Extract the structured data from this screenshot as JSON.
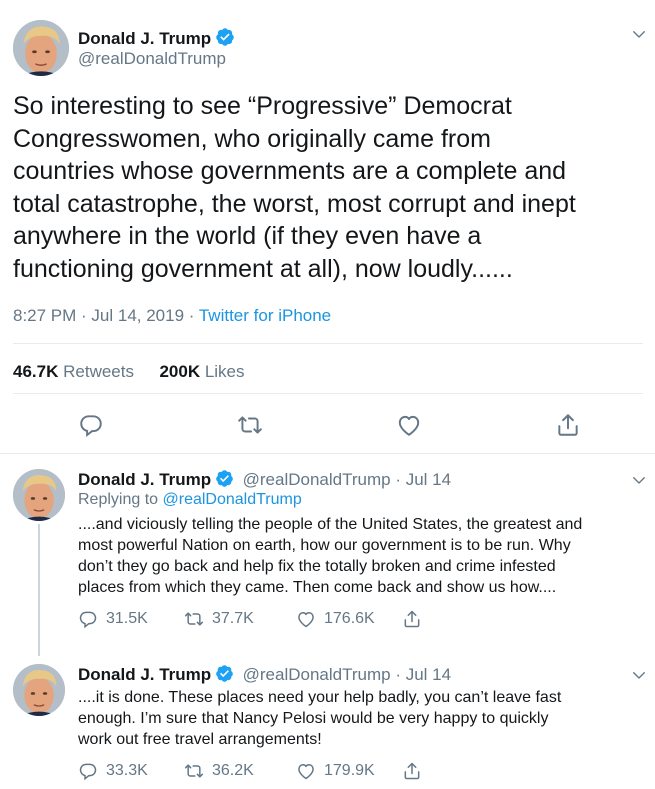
{
  "main": {
    "author_name": "Donald J. Trump",
    "author_handle": "@realDonaldTrump",
    "text": "So interesting to see “Progressive” Democrat\nCongresswomen, who originally came from\ncountries whose governments are a complete and\ntotal catastrophe, the worst, most corrupt and inept\nanywhere in the world (if they even have a\nfunctioning government at all), now loudly......",
    "time": "8:27 PM · Jul 14, 2019 · ",
    "source": "Twitter for iPhone",
    "retweets_count": "46.7K",
    "retweets_label": "Retweets",
    "likes_count": "200K",
    "likes_label": "Likes"
  },
  "replies": [
    {
      "author_name": "Donald J. Trump",
      "handle_date": "@realDonaldTrump · Jul 14",
      "replying_label": "Replying to ",
      "replying_handle": "@realDonaldTrump",
      "text": "....and viciously telling the people of the United States, the greatest and\nmost powerful Nation on earth, how our government is to be run. Why\ndon’t they go back and help fix the totally broken and crime infested\nplaces from which they came. Then come back and show us how....",
      "reply_count": "31.5K",
      "retweet_count": "37.7K",
      "like_count": "176.6K"
    },
    {
      "author_name": "Donald J. Trump",
      "handle_date": "@realDonaldTrump · Jul 14",
      "text": "....it is done. These places need your help badly, you can’t leave fast\nenough. I’m sure that Nancy Pelosi would be very happy to quickly\nwork out free travel arrangements!",
      "reply_count": "33.3K",
      "retweet_count": "36.2K",
      "like_count": "179.9K"
    }
  ],
  "icons": {
    "verified": "verified-badge-icon",
    "reply": "reply-icon",
    "retweet": "retweet-icon",
    "like": "like-icon",
    "share": "share-icon",
    "more": "chevron-down-icon"
  },
  "colors": {
    "accent": "#1da1f2",
    "link": "#1b95e0",
    "muted": "#657786",
    "text": "#14171a",
    "divider": "#e6ecf0"
  }
}
